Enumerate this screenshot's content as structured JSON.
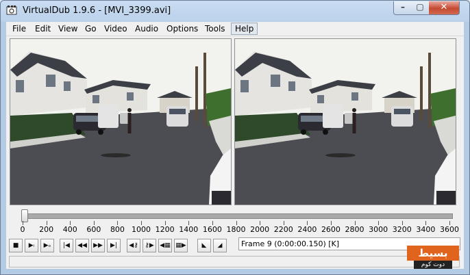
{
  "window": {
    "title": "VirtualDub 1.9.6 - [MVI_3399.avi]"
  },
  "title_controls": {
    "minimize": "–",
    "maximize": "▢",
    "close": "✕"
  },
  "menu": [
    "File",
    "Edit",
    "View",
    "Go",
    "Video",
    "Audio",
    "Options",
    "Tools",
    "Help"
  ],
  "menu_active": "Help",
  "timeline": {
    "tick_labels": [
      "0",
      "200",
      "400",
      "600",
      "800",
      "1000",
      "1200",
      "1400",
      "1600",
      "1800",
      "2000",
      "2200",
      "2400",
      "2600",
      "2800",
      "3000",
      "3200",
      "3400",
      "3600"
    ],
    "max": 3600,
    "position": 9
  },
  "toolbar": [
    {
      "name": "stop-button",
      "icon": "stop-icon",
      "glyph": "■"
    },
    {
      "name": "play-input-button",
      "icon": "play-input-icon",
      "glyph": "▶ᵢ"
    },
    {
      "name": "play-output-button",
      "icon": "play-output-icon",
      "glyph": "▶ₒ"
    },
    {
      "name": "go-to-start-button",
      "icon": "go-to-start-icon",
      "glyph": "|◀"
    },
    {
      "name": "step-backward-button",
      "icon": "step-backward-icon",
      "glyph": "◀◀"
    },
    {
      "name": "step-forward-button",
      "icon": "step-forward-icon",
      "glyph": "▶▶"
    },
    {
      "name": "go-to-end-button",
      "icon": "go-to-end-icon",
      "glyph": "▶|"
    },
    {
      "name": "previous-keyframe-button",
      "icon": "previous-keyframe-icon",
      "glyph": "◀⚷"
    },
    {
      "name": "next-keyframe-button",
      "icon": "next-keyframe-icon",
      "glyph": "⚷▶"
    },
    {
      "name": "previous-scene-button",
      "icon": "previous-scene-icon",
      "glyph": "◀▦"
    },
    {
      "name": "next-scene-button",
      "icon": "next-scene-icon",
      "glyph": "▦▶"
    },
    {
      "name": "mark-in-button",
      "icon": "mark-in-icon",
      "glyph": "◣"
    },
    {
      "name": "mark-out-button",
      "icon": "mark-out-icon",
      "glyph": "◢"
    }
  ],
  "frame_info": "Frame 9 (0:00:00.150) [K]",
  "watermark": {
    "main": "بسيط",
    "sub": "دوت كوم"
  },
  "colors": {
    "window_frame": "#bcd2eb",
    "close_button": "#c44a31",
    "watermark": "#e0641e"
  }
}
